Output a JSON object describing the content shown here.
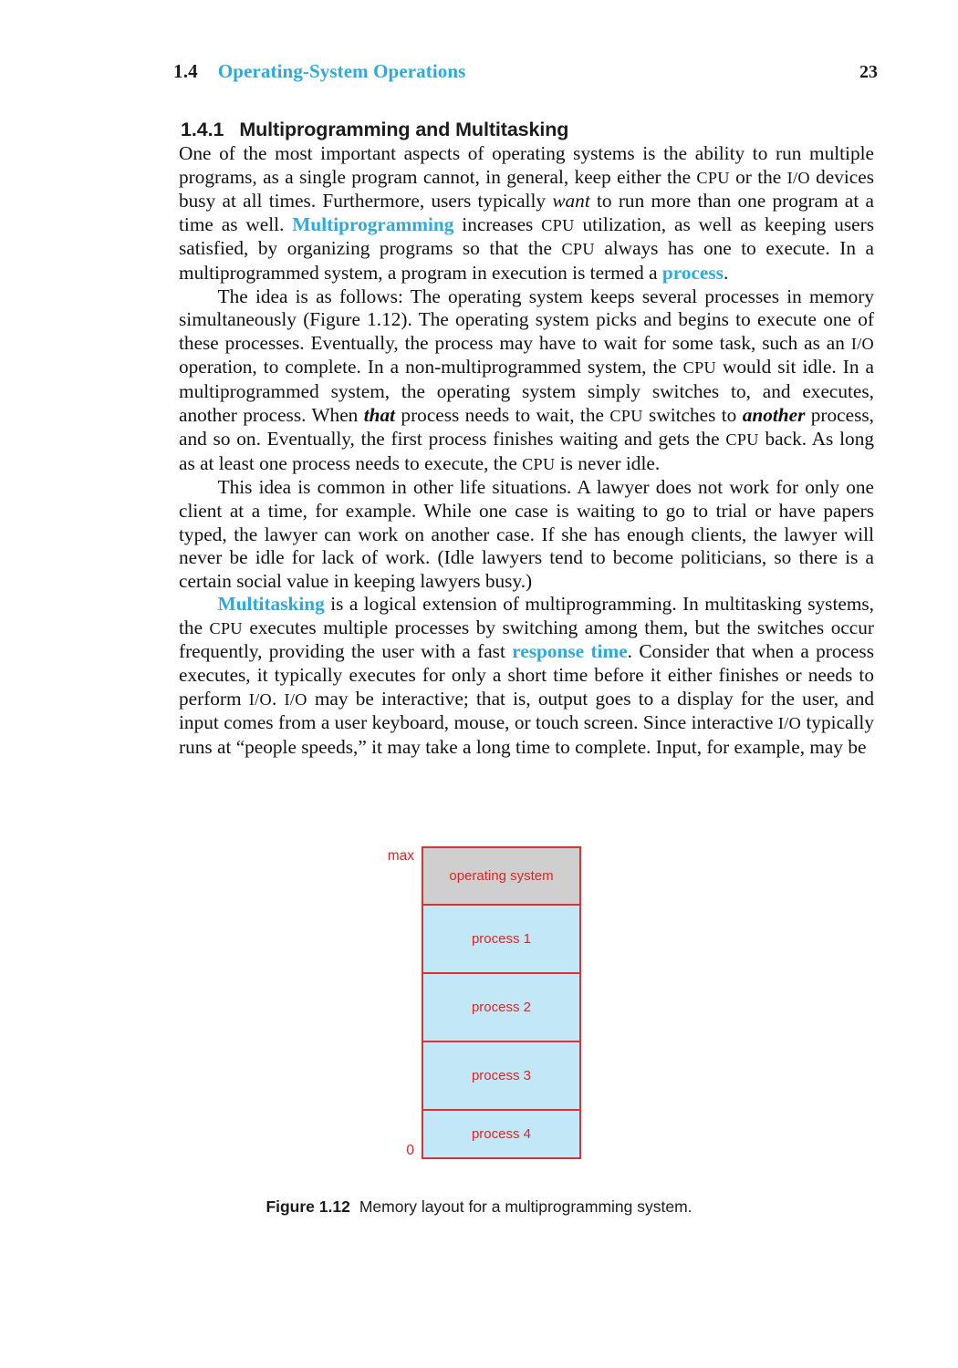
{
  "header": {
    "section_number": "1.4",
    "section_title": "Operating-System Operations",
    "page_number": "23",
    "title_color": "#29abe2"
  },
  "heading": {
    "number": "1.4.1",
    "text": "Multiprogramming and Multitasking"
  },
  "paragraphs": {
    "p1": {
      "s1": "One of the most important aspects of operating systems is the ability to run multiple programs, as a single program cannot, in general, keep either the ",
      "acr1": "CPU",
      "s2": " or the ",
      "acr2": "I/O",
      "s3": " devices busy at all times. Furthermore, users typically ",
      "em1": "want",
      "s4": " to run more than one program at a time as well. ",
      "term1": "Multiprogramming",
      "s5": " increases ",
      "acr3": "CPU",
      "s6": " utilization, as well as keeping users satisfied, by organizing programs so that the ",
      "acr4": "CPU",
      "s7": " always has one to execute. In a multiprogrammed system, a program in execution is termed a ",
      "term2": "process",
      "s8": "."
    },
    "p2": {
      "s1": "The idea is as follows: The operating system keeps several processes in memory simultaneously (Figure 1.12). The operating system picks and begins to execute one of these processes. Eventually, the process may have to wait for some task, such as an ",
      "acr1": "I/O",
      "s2": " operation, to complete. In a non-multiprogrammed system, the ",
      "acr2": "CPU",
      "s3": " would sit idle. In a multiprogrammed system, the operating system simply switches to, and executes, another process. When ",
      "em1": "that",
      "s4": " process needs to wait, the ",
      "acr3": "CPU",
      "s5": " switches to ",
      "em2": "another",
      "s6": " process, and so on. Eventually, the first process finishes waiting and gets the ",
      "acr4": "CPU",
      "s7": " back. As long as at least one process needs to execute, the ",
      "acr5": "CPU",
      "s8": " is never idle."
    },
    "p3": {
      "s1": "This idea is common in other life situations. A lawyer does not work for only one client at a time, for example. While one case is waiting to go to trial or have papers typed, the lawyer can work on another case. If she has enough clients, the lawyer will never be idle for lack of work. (Idle lawyers tend to become politicians, so there is a certain social value in keeping lawyers busy.)"
    },
    "p4": {
      "term1": "Multitasking",
      "s1": " is a logical extension of multiprogramming. In multitasking systems, the ",
      "acr1": "CPU",
      "s2": " executes multiple processes by switching among them, but the switches occur frequently, providing the user with a fast ",
      "term2": "response time",
      "s3": ". Consider that when a process executes, it typically executes for only a short time before it either finishes or needs to perform ",
      "acr2": "I/O",
      "s4": ". ",
      "acr3": "I/O",
      "s5": " may be interactive; that is, output goes to a display for the user, and input comes from a user keyboard, mouse, or touch screen. Since interactive ",
      "acr4": "I/O",
      "s6": " typically runs at “people speeds,” it may take a long time to complete. Input, for example, may be"
    }
  },
  "figure": {
    "axis_top_label": "max",
    "axis_bottom_label": "0",
    "blocks": [
      {
        "label": "operating system",
        "fill": "#cfcfcf"
      },
      {
        "label": "process 1",
        "fill": "#c2e8f8"
      },
      {
        "label": "process 2",
        "fill": "#c2e8f8"
      },
      {
        "label": "process 3",
        "fill": "#c2e8f8"
      },
      {
        "label": "process 4",
        "fill": "#c2e8f8"
      }
    ],
    "border_color": "#e03030",
    "text_color": "#e02424",
    "caption_number": "Figure 1.12",
    "caption_text": "Memory layout for a multiprogramming system."
  }
}
